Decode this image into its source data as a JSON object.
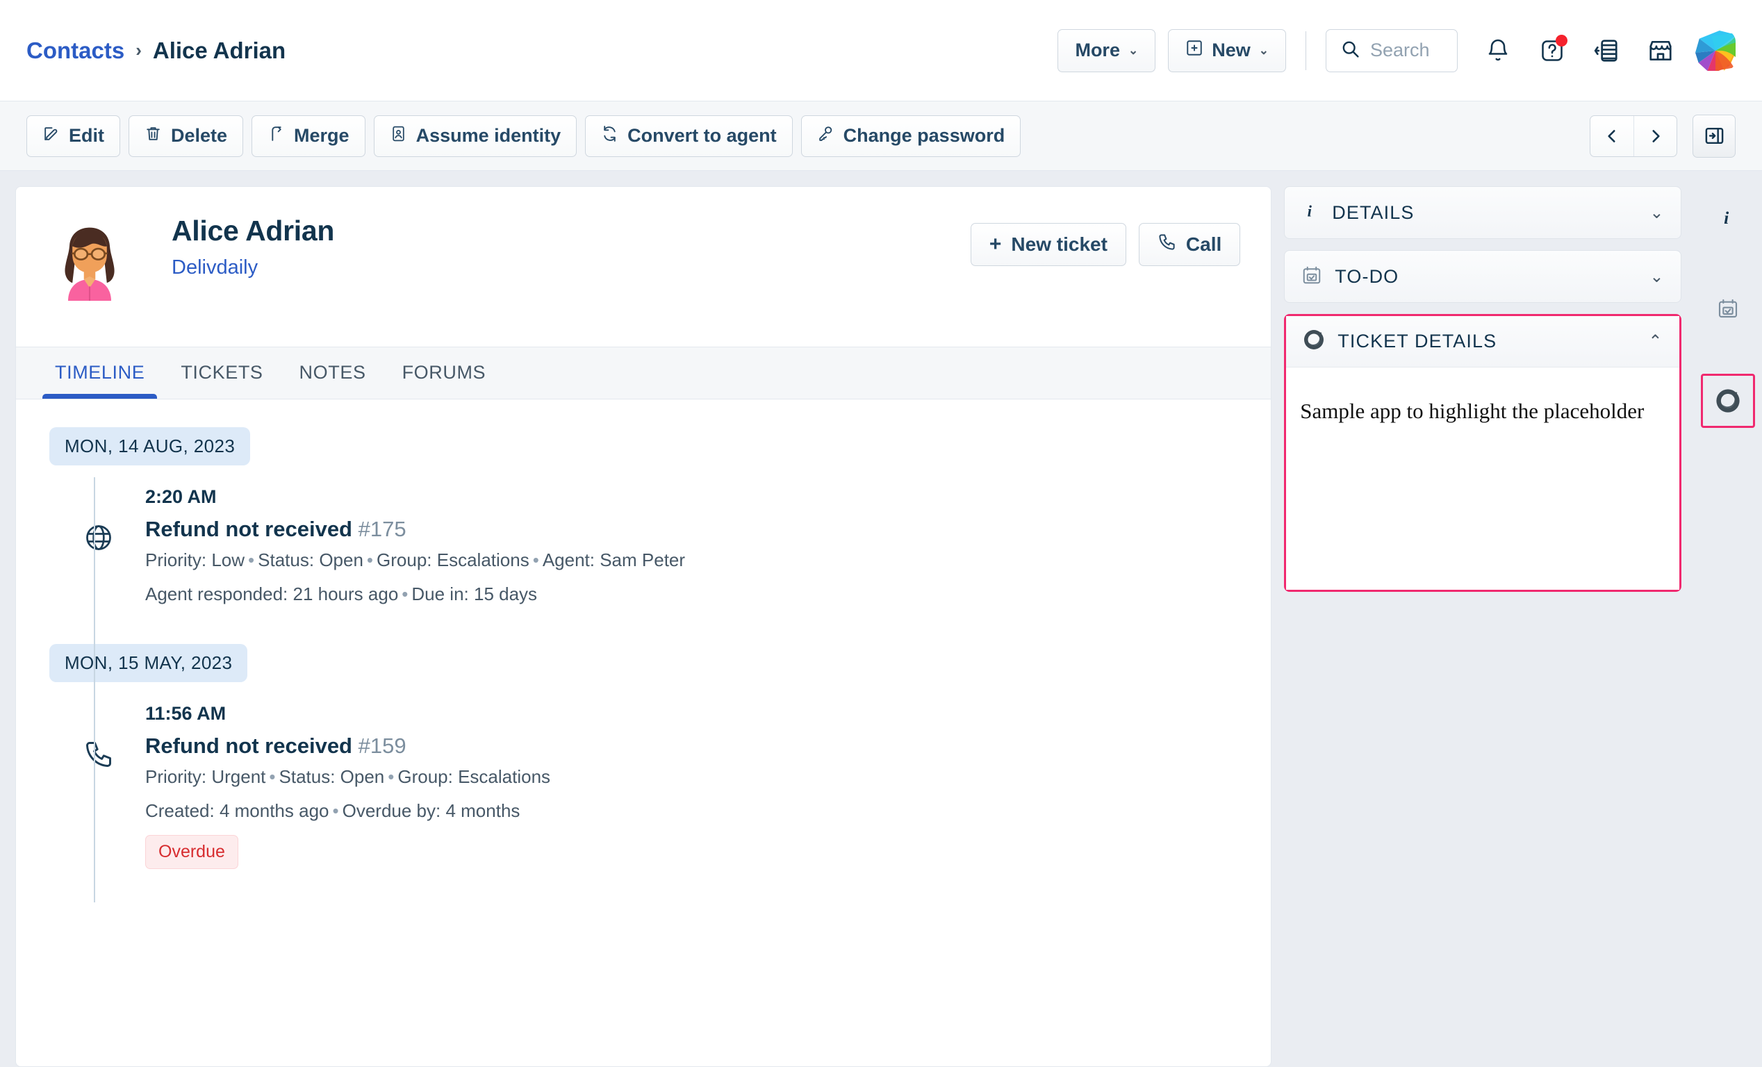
{
  "header": {
    "breadcrumb": {
      "parent": "Contacts",
      "separator": "›",
      "current": "Alice Adrian"
    },
    "more_label": "More",
    "new_label": "New",
    "search_placeholder": "Search",
    "icons": {
      "search": "search-icon",
      "notification": "bell-icon",
      "help": "help-question-icon",
      "switcher": "switch-product-icon",
      "marketplace": "marketplace-storefront-icon",
      "logo": "freshworks-logo"
    }
  },
  "toolbar": {
    "buttons": [
      {
        "label": "Edit",
        "icon": "pencil-square-icon"
      },
      {
        "label": "Delete",
        "icon": "trash-icon"
      },
      {
        "label": "Merge",
        "icon": "merge-arrow-icon"
      },
      {
        "label": "Assume identity",
        "icon": "person-card-icon"
      },
      {
        "label": "Convert to agent",
        "icon": "refresh-cycle-icon"
      },
      {
        "label": "Change password",
        "icon": "key-icon"
      }
    ],
    "prev_label": "‹",
    "next_label": "›",
    "panel_toggle": "collapse-panel-icon"
  },
  "profile": {
    "name": "Alice Adrian",
    "company": "Delivdaily",
    "avatar": "woman-with-glasses-avatar",
    "new_ticket_label": "New ticket",
    "new_ticket_icon": "plus-icon",
    "call_label": "Call",
    "call_icon": "phone-icon"
  },
  "tabs": [
    {
      "label": "TIMELINE",
      "active": true
    },
    {
      "label": "TICKETS",
      "active": false
    },
    {
      "label": "NOTES",
      "active": false
    },
    {
      "label": "FORUMS",
      "active": false
    }
  ],
  "timeline": [
    {
      "date": "MON, 14 AUG, 2023",
      "items": [
        {
          "icon": "globe-icon",
          "time": "2:20 AM",
          "title": "Refund not received",
          "number": "#175",
          "meta_line_1": [
            "Priority: Low",
            "Status: Open",
            "Group: Escalations",
            "Agent: Sam Peter"
          ],
          "meta_line_2": [
            "Agent responded: 21 hours ago",
            "Due in: 15 days"
          ],
          "badge": null
        }
      ]
    },
    {
      "date": "MON, 15 MAY, 2023",
      "items": [
        {
          "icon": "phone-icon",
          "time": "11:56 AM",
          "title": "Refund not received",
          "number": "#159",
          "meta_line_1": [
            "Priority: Urgent",
            "Status: Open",
            "Group: Escalations"
          ],
          "meta_line_2": [
            "Created: 4 months ago",
            "Overdue by: 4 months"
          ],
          "badge": "Overdue"
        }
      ]
    }
  ],
  "sidebar": {
    "panels": [
      {
        "title": "DETAILS",
        "icon": "info-italic-i-icon",
        "chevron": "⌄",
        "expanded": false
      },
      {
        "title": "TO-DO",
        "icon": "calendar-check-icon",
        "chevron": "⌄",
        "expanded": false
      },
      {
        "title": "TICKET DETAILS",
        "icon": "spiral-app-icon",
        "chevron": "⌃",
        "expanded": true,
        "body_text": "Sample app to highlight the placeholder"
      }
    ]
  },
  "rail": [
    {
      "icon": "info-italic-i-icon",
      "selected": false
    },
    {
      "icon": "calendar-check-icon",
      "selected": false
    },
    {
      "icon": "spiral-app-icon",
      "selected": true
    }
  ],
  "colors": {
    "accent_blue": "#2c5cc5",
    "highlight_pink": "#f0296f",
    "overdue_red": "#d72d30",
    "page_bg": "#eaedf2",
    "text_dark": "#12344d"
  }
}
